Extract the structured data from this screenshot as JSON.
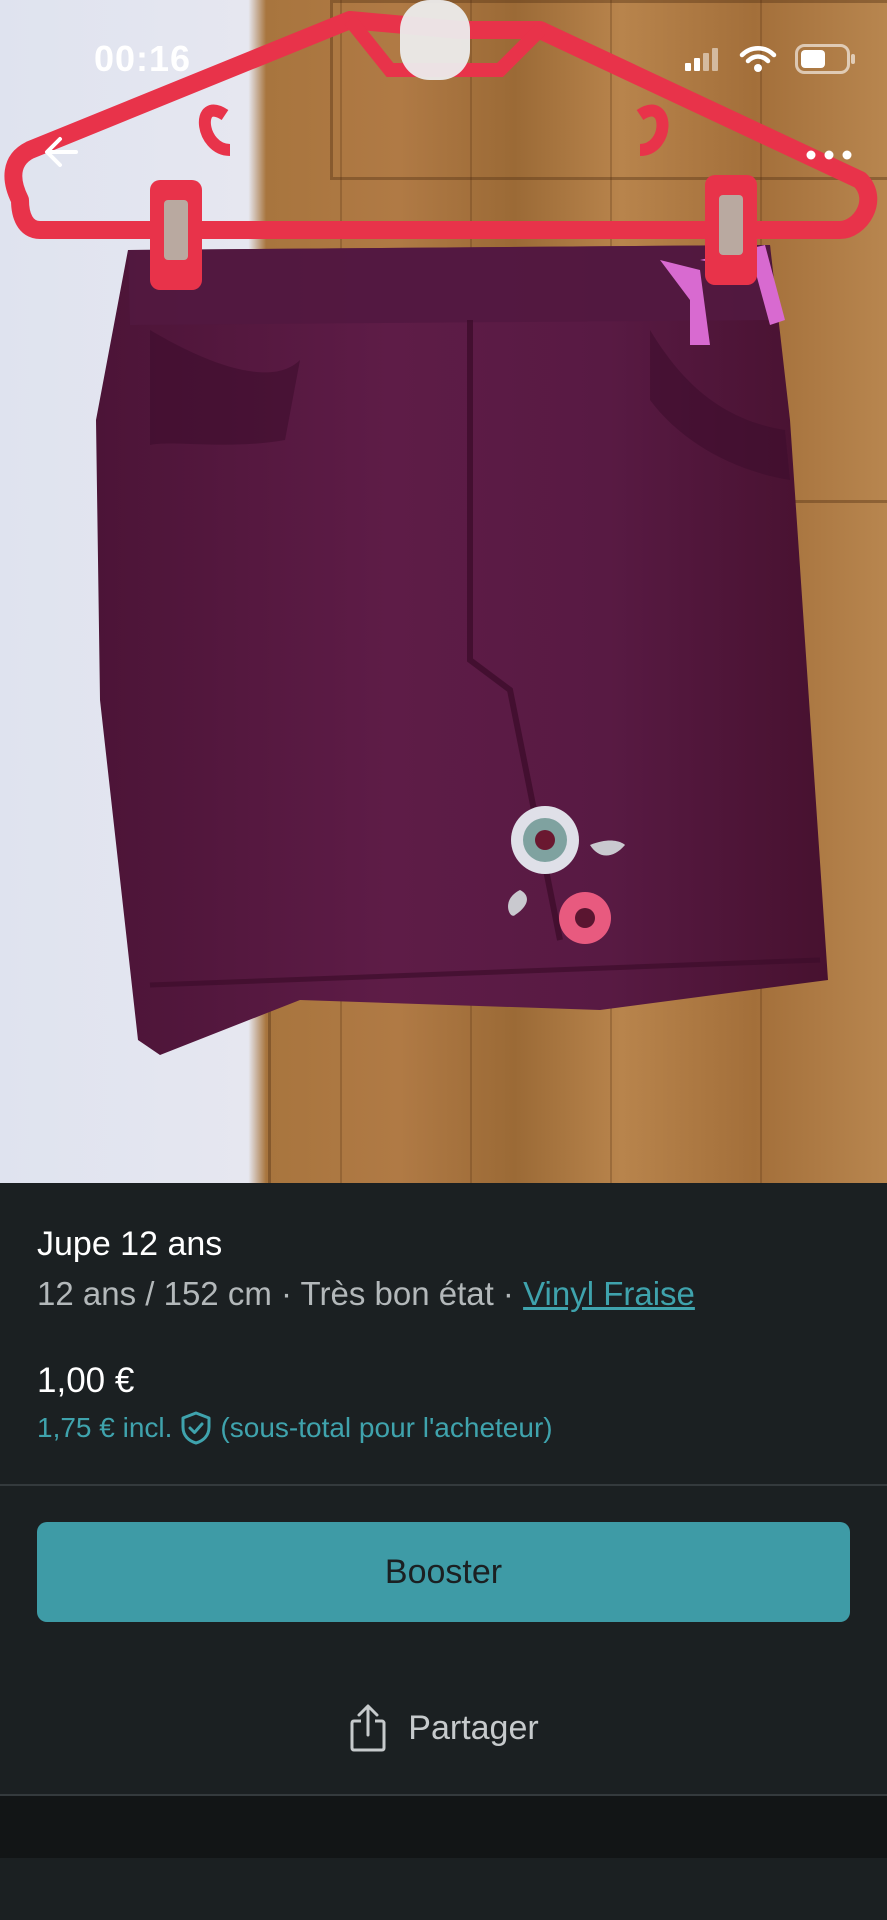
{
  "status_bar": {
    "time": "00:16"
  },
  "icons": {
    "back": "arrow-left-icon",
    "more": "more-dots-icon",
    "signal": "signal-icon",
    "wifi": "wifi-icon",
    "battery": "battery-icon",
    "protection": "shield-check-icon",
    "share": "share-icon"
  },
  "item": {
    "title": "Jupe 12 ans",
    "size": "12 ans / 152 cm",
    "separator": " · ",
    "condition": "Très bon état",
    "brand": "Vinyl Fraise",
    "price": "1,00 €",
    "price_incl": "1,75 € incl.",
    "price_incl_note": "(sous-total pour l'acheteur)"
  },
  "actions": {
    "booster_label": "Booster",
    "share_label": "Partager"
  },
  "colors": {
    "accent": "#3e9ba6",
    "link": "#3fa3ad",
    "background": "#1b2022",
    "skirt": "#5a1a44",
    "hanger": "#e8334a"
  }
}
